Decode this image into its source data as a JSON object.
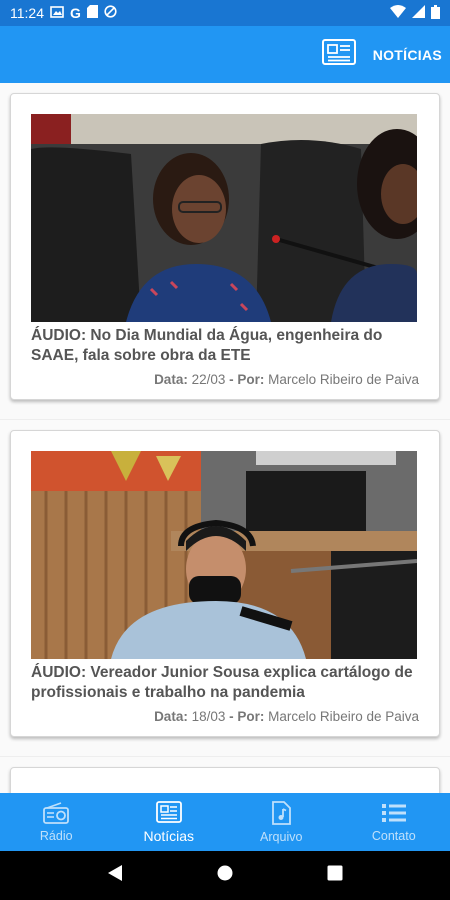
{
  "status_bar": {
    "time": "11:24"
  },
  "app_bar": {
    "title": "NOTÍCIAS",
    "icon": "newspaper-icon"
  },
  "news": [
    {
      "title": "ÁUDIO: No Dia Mundial da Água, engenheira do SAAE, fala sobre obra da ETE",
      "date_label": "Data:",
      "date": "22/03",
      "author_label": "- Por:",
      "author": "Marcelo Ribeiro de Paiva"
    },
    {
      "title": "ÁUDIO: Vereador Junior Sousa explica cartálogo de profissionais e trabalho na pandemia",
      "date_label": "Data:",
      "date": "18/03",
      "author_label": "- Por:",
      "author": "Marcelo Ribeiro de Paiva"
    }
  ],
  "bottom_nav": {
    "items": [
      {
        "label": "Rádio",
        "icon": "radio-icon"
      },
      {
        "label": "Notícias",
        "icon": "newspaper-icon",
        "active": true
      },
      {
        "label": "Arquivo",
        "icon": "audio-file-icon"
      },
      {
        "label": "Contato",
        "icon": "list-icon"
      }
    ]
  },
  "colors": {
    "primary": "#2196f3",
    "status_bar": "#1976d2",
    "inactive_nav": "#bfe0fb"
  }
}
